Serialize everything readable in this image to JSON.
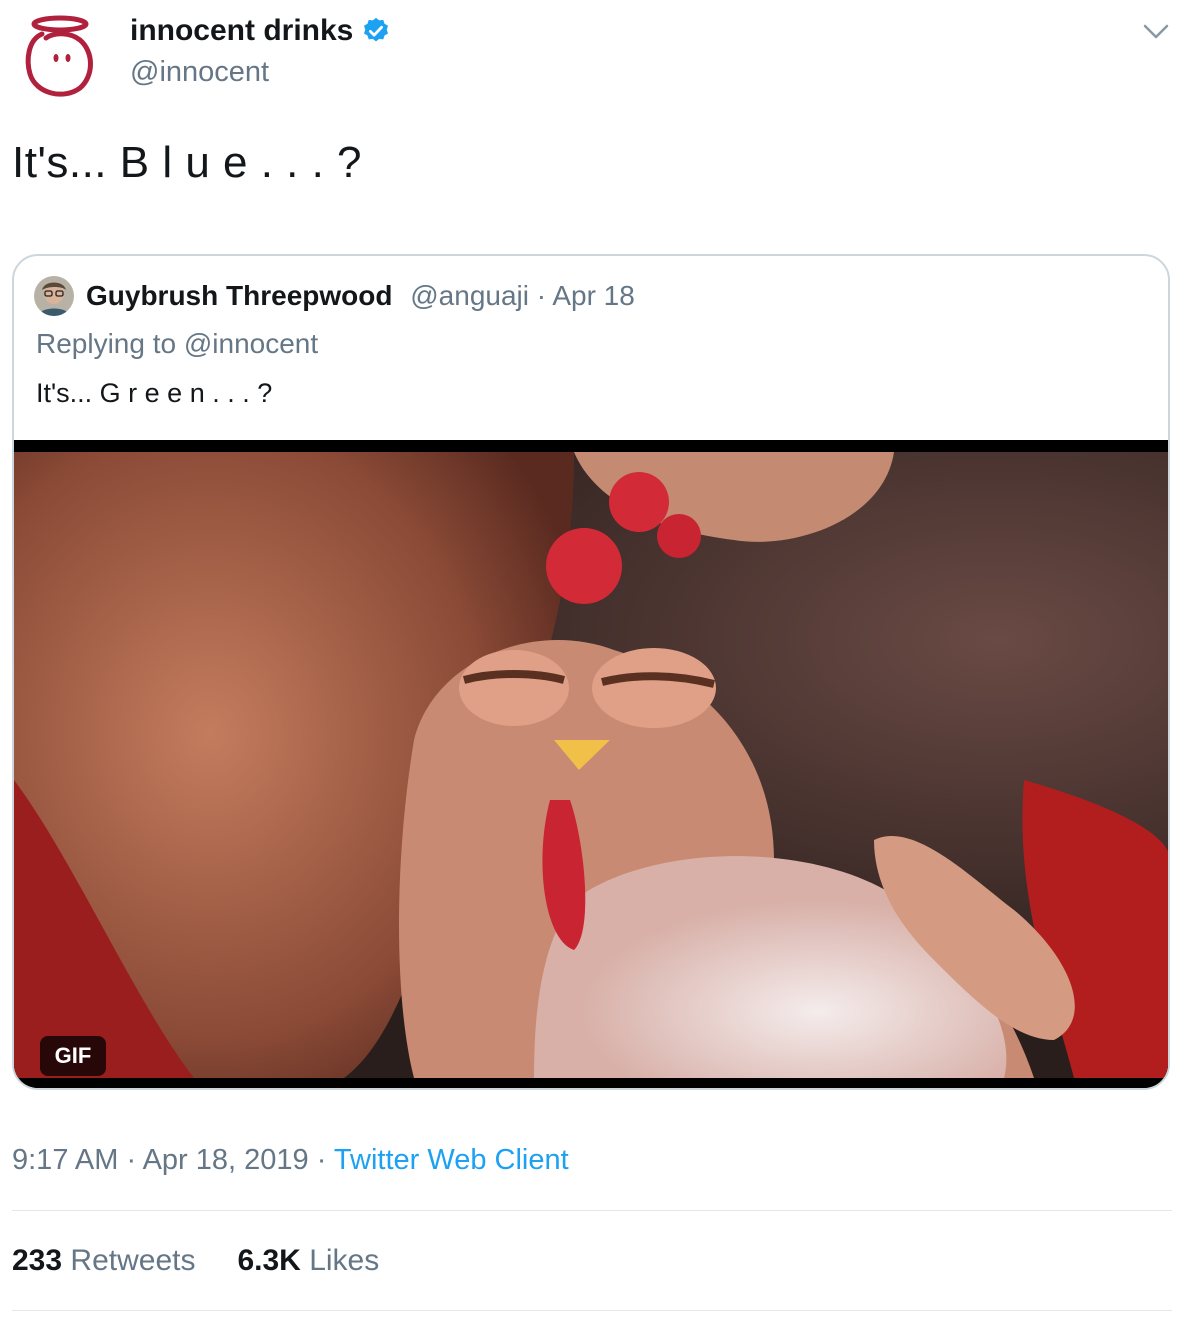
{
  "author": {
    "name": "innocent drinks",
    "handle": "@innocent",
    "avatar_icon": "innocent-logo-icon",
    "verified_icon": "verified-badge-icon",
    "verified_color": "#1da1f2"
  },
  "tweet": {
    "text": "It's... B l u e . . . ?"
  },
  "quoted_tweet": {
    "author_name": "Guybrush Threepwood",
    "handle": "@anguaji",
    "separator": " · ",
    "date": "Apr 18",
    "replying_to": "Replying to @innocent",
    "text": "It's... G r e e n . . . ?",
    "media_badge": "GIF"
  },
  "details": {
    "time": "9:17 AM",
    "separator": " · ",
    "date": "Apr 18, 2019",
    "client": "Twitter Web Client"
  },
  "stats": {
    "retweets_count": "233",
    "retweets_label": "Retweets",
    "likes_count": "6.3K",
    "likes_label": "Likes"
  },
  "colors": {
    "text": "#14171a",
    "muted": "#657786",
    "link": "#1da1f2",
    "border": "#ccd6dd",
    "logo": "#b0213e"
  }
}
